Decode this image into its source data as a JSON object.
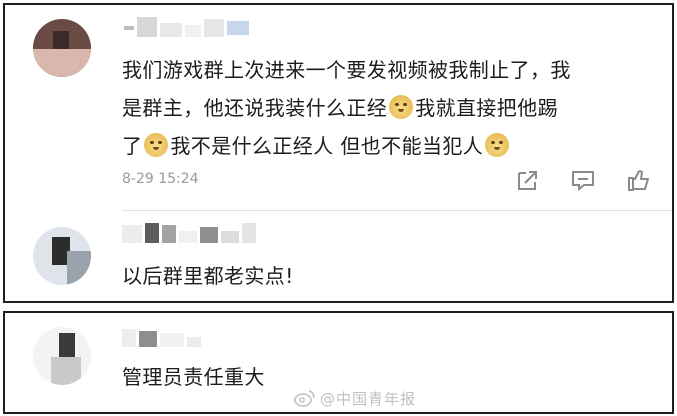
{
  "comments": [
    {
      "text_line1": "我们游戏群上次进来一个要发视频被我制止了，我",
      "text_line2_a": "是群主，他还说我装什么正经",
      "text_line2_b": "我就直接把他踢",
      "text_line3_a": "了",
      "text_line3_b": "我不是什么正经人 但也不能当犯人",
      "time": "8-29 15:24"
    },
    {
      "text": "以后群里都老实点!"
    },
    {
      "text": "管理员责任重大"
    }
  ],
  "watermark": {
    "text": "@中国青年报"
  },
  "icons": [
    "share-icon",
    "comment-icon",
    "like-icon",
    "doge-emoji-icon",
    "weibo-logo-icon"
  ]
}
